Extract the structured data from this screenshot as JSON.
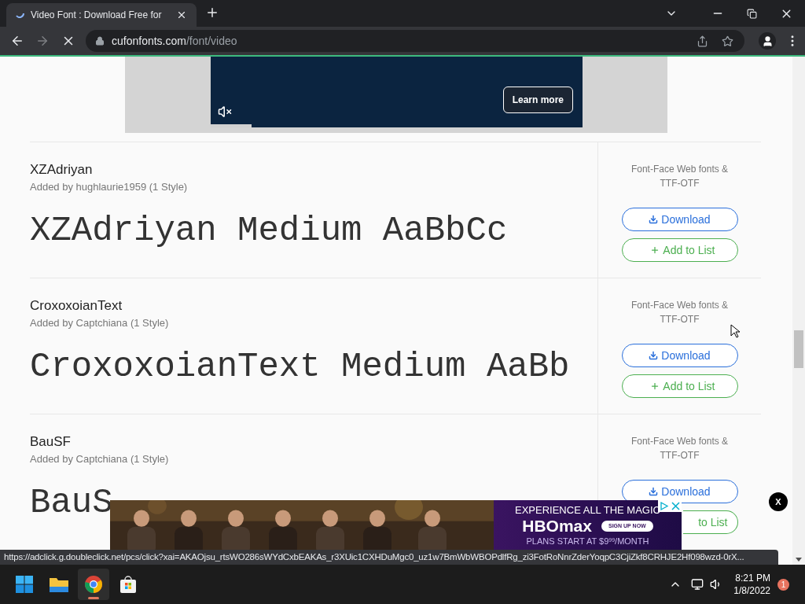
{
  "browser": {
    "tab_title": "Video Font : Download Free for",
    "loading": true,
    "url_domain": "cufonfonts.com",
    "url_path": "/font/video"
  },
  "video_ad": {
    "button": "Learn more",
    "muted": true,
    "level": 0.11
  },
  "fonts": [
    {
      "name": "XZAdriyan",
      "byline": "Added by hughlaurie1959 (1 Style)",
      "sample": "XZAdriyan Medium AaBbCc",
      "formats": "Font-Face Web fonts & TTF-OTF",
      "download": "Download",
      "add": "Add to List"
    },
    {
      "name": "CroxoxoianText",
      "byline": "Added by Captchiana (1 Style)",
      "sample": "CroxoxoianText Medium AaBb",
      "formats": "Font-Face Web fonts & TTF-OTF",
      "download": "Download",
      "add": "Add to List"
    },
    {
      "name": "BauSF",
      "byline": "Added by Captchiana (1 Style)",
      "sample": "BauS",
      "formats": "Font-Face Web fonts & TTF-OTF",
      "download": "Download",
      "add": "to List"
    }
  ],
  "banner_ad": {
    "headline": "EXPERIENCE ALL THE MAGIC",
    "brand": "HBOmax",
    "cta": "SIGN UP NOW",
    "offer": "PLANS START AT $9",
    "offer_cents": "99",
    "offer_unit": "/MONTH",
    "close_label": "X"
  },
  "status_url": "https://adclick.g.doubleclick.net/pcs/click?xai=AKAOjsu_rtsWO286sWYdCxbEAKAs_r3XUic1CXHDuMgc0_uz1w7BmWbWBOPdlfRg_zi3FotRoNnrZderYoqpC3CjiZkf8CRHJE2Hf098wzd-0rX...",
  "taskbar": {
    "apps": [
      {
        "kind": "start",
        "selected": false
      },
      {
        "kind": "folder",
        "selected": false
      },
      {
        "kind": "chrome",
        "selected": true
      },
      {
        "kind": "store",
        "selected": false
      }
    ],
    "time": "8:21 PM",
    "date": "1/8/2022",
    "notifications": "1"
  }
}
